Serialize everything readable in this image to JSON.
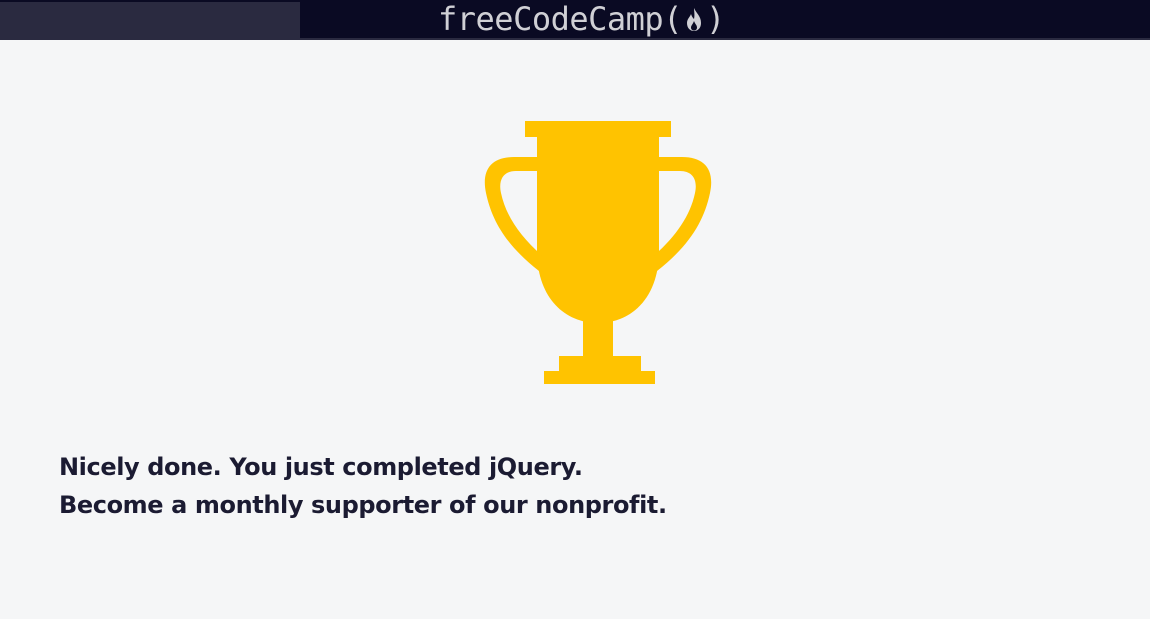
{
  "navbar": {
    "logo_text": "freeCodeCamp",
    "logo_open": "(",
    "logo_close": ")",
    "background": "#0a0a23",
    "search_background": "#2a2a40"
  },
  "icons": {
    "logo_flame": "flame-icon",
    "trophy": "trophy-icon"
  },
  "colors": {
    "trophy": "#ffc300",
    "text": "#1b1b32",
    "page_background": "#f5f6f7"
  },
  "completion": {
    "line1": "Nicely done. You just completed jQuery.",
    "line2": "Become a monthly supporter of our nonprofit."
  }
}
